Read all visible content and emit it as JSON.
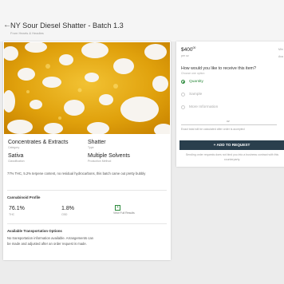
{
  "header": {
    "title": "NY Sour Diesel Shatter - Batch 1.3",
    "subtitle": "From Hearts & Headies"
  },
  "product": {
    "category": {
      "value": "Concentrates & Extracts",
      "label": "Category"
    },
    "type": {
      "value": "Shatter",
      "label": "Type"
    },
    "classification": {
      "value": "Sativa",
      "label": "Classification"
    },
    "production_method": {
      "value": "Multiple Solvents",
      "label": "Production Method"
    },
    "description": "77% THC, 5.2% terpene content, no residual hydrocarbons, this batch came out pretty bubbly"
  },
  "cannabinoids": {
    "title": "Cannabinoid Profile",
    "thc": {
      "value": "76.1%",
      "label": "THC"
    },
    "cbd": {
      "value": "1.8%",
      "label": "CBD"
    },
    "view_full": "View Full Results"
  },
  "transportation": {
    "title": "Available Transportation Options",
    "text": "No transportation information available. Arrangements can be made and adjusted after an order request is made."
  },
  "order": {
    "price": "$400",
    "price_cents": "00",
    "price_unit": "per oz",
    "min_label": "Min",
    "min_label2": "Ava",
    "question": "How would you like to receive this item?",
    "question_sub": "Choose one option",
    "options": [
      {
        "label": "Quantity",
        "selected": true
      },
      {
        "label": "Sample",
        "selected": false
      },
      {
        "label": "More Information",
        "selected": false
      }
    ],
    "qty_unit": "oz",
    "qty_hint": "Exact total will be calculated after order is accepted",
    "add_button": "+ ADD TO REQUEST",
    "disclaimer": "Sending order requests does not bind you into a business contract with this counterparty."
  },
  "colors": {
    "accent_green": "#2c8a3c",
    "button_dark": "#2a3f4d"
  }
}
